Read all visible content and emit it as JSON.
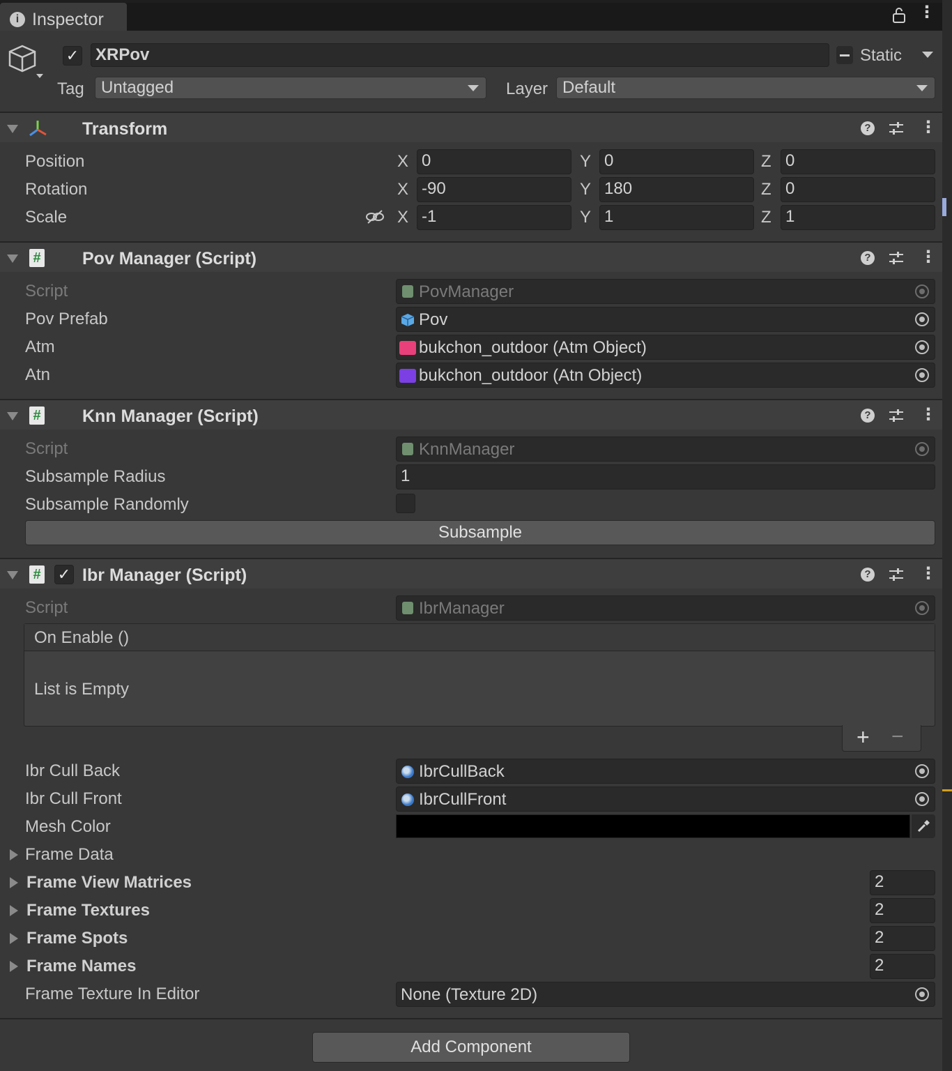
{
  "tab": {
    "title": "Inspector"
  },
  "header": {
    "name": "XRPov",
    "active": true,
    "static_label": "Static",
    "tag_label": "Tag",
    "tag_value": "Untagged",
    "layer_label": "Layer",
    "layer_value": "Default"
  },
  "transform": {
    "title": "Transform",
    "rows": [
      {
        "label": "Position",
        "x": "0",
        "y": "0",
        "z": "0"
      },
      {
        "label": "Rotation",
        "x": "-90",
        "y": "180",
        "z": "0"
      },
      {
        "label": "Scale",
        "x": "-1",
        "y": "1",
        "z": "1"
      }
    ],
    "axes": {
      "x": "X",
      "y": "Y",
      "z": "Z"
    }
  },
  "pov_manager": {
    "title": "Pov Manager (Script)",
    "script_label": "Script",
    "script_value": "PovManager",
    "fields": [
      {
        "label": "Pov Prefab",
        "value": "Pov",
        "icon": "prefab-cube-icon",
        "icon_color": "#5aa9e6"
      },
      {
        "label": "Atm",
        "value": "bukchon_outdoor (Atm Object)",
        "icon": "atm-asset-icon",
        "icon_color": "#e8407a"
      },
      {
        "label": "Atn",
        "value": "bukchon_outdoor (Atn Object)",
        "icon": "atn-asset-icon",
        "icon_color": "#7b3fe4"
      }
    ]
  },
  "knn_manager": {
    "title": "Knn Manager (Script)",
    "script_label": "Script",
    "script_value": "KnnManager",
    "radius_label": "Subsample Radius",
    "radius_value": "1",
    "randomly_label": "Subsample Randomly",
    "randomly_checked": false,
    "button_label": "Subsample"
  },
  "ibr_manager": {
    "title": "Ibr Manager (Script)",
    "enabled": true,
    "script_label": "Script",
    "script_value": "IbrManager",
    "event_title": "On Enable ()",
    "event_empty": "List is Empty",
    "add_symbol": "+",
    "remove_symbol": "−",
    "cull_back_label": "Ibr Cull Back",
    "cull_back_value": "IbrCullBack",
    "cull_front_label": "Ibr Cull Front",
    "cull_front_value": "IbrCullFront",
    "mesh_color_label": "Mesh Color",
    "mesh_color_value": "#000000",
    "frame_data_label": "Frame Data",
    "arrays": [
      {
        "label": "Frame View Matrices",
        "count": "2"
      },
      {
        "label": "Frame Textures",
        "count": "2"
      },
      {
        "label": "Frame Spots",
        "count": "2"
      },
      {
        "label": "Frame Names",
        "count": "2"
      }
    ],
    "texture_label": "Frame Texture In Editor",
    "texture_value": "None (Texture 2D)"
  },
  "footer": {
    "add_component_label": "Add Component"
  }
}
